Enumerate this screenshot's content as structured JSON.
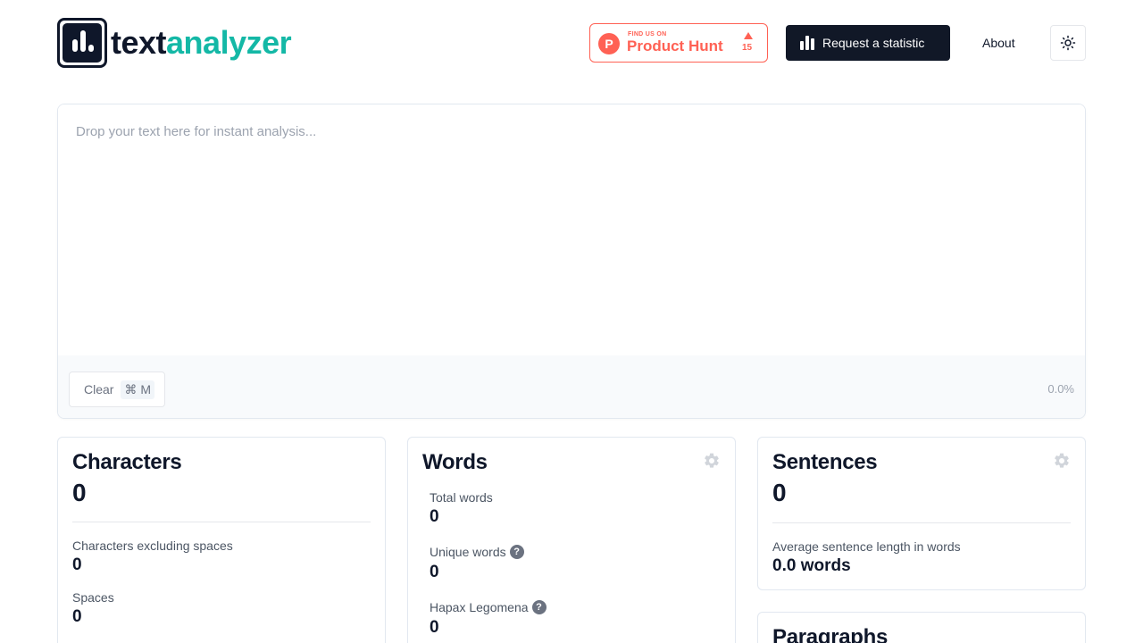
{
  "header": {
    "logo_text_dark": "text",
    "logo_text_accent": "analyzer",
    "product_hunt": {
      "small_text": "FIND US ON",
      "big_text": "Product Hunt",
      "logo_letter": "P",
      "upvotes": "15"
    },
    "request_button_label": "Request a statistic",
    "about_label": "About",
    "theme_icon": "sun-icon"
  },
  "editor": {
    "placeholder": "Drop your text here for instant analysis...",
    "value": "",
    "clear_label": "Clear",
    "clear_shortcut": "⌘ M",
    "progress_text": "0.0%"
  },
  "cards": {
    "characters": {
      "title": "Characters",
      "total": "0",
      "excluding_spaces_label": "Characters excluding spaces",
      "excluding_spaces_value": "0",
      "spaces_label": "Spaces",
      "spaces_value": "0"
    },
    "words": {
      "title": "Words",
      "total_label": "Total words",
      "total_value": "0",
      "unique_label": "Unique words",
      "unique_value": "0",
      "hapax_label": "Hapax Legomena",
      "hapax_value": "0"
    },
    "sentences": {
      "title": "Sentences",
      "total": "0",
      "avg_label": "Average sentence length in words",
      "avg_value": "0.0 words"
    },
    "paragraphs": {
      "title": "Paragraphs"
    }
  },
  "colors": {
    "accent": "#14b8a6",
    "dark": "#0f172a",
    "product_hunt": "#ff6154"
  }
}
